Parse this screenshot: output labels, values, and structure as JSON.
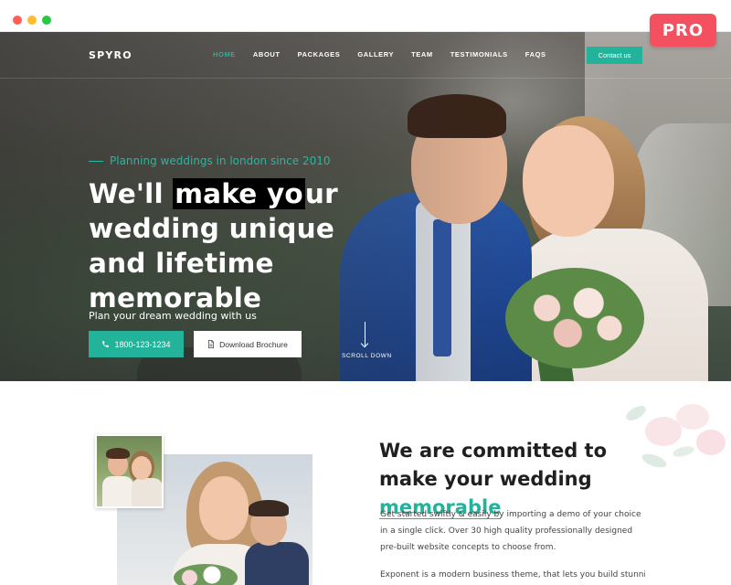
{
  "badge": {
    "label": "PRO"
  },
  "header": {
    "logo": "SPYRO",
    "nav": [
      {
        "label": "HOME",
        "active": true
      },
      {
        "label": "ABOUT",
        "active": false
      },
      {
        "label": "PACKAGES",
        "active": false
      },
      {
        "label": "GALLERY",
        "active": false
      },
      {
        "label": "TEAM",
        "active": false
      },
      {
        "label": "TESTIMONIALS",
        "active": false
      },
      {
        "label": "FAQS",
        "active": false
      }
    ],
    "contact_label": "Contact us"
  },
  "hero": {
    "tagline": "Planning weddings in london since 2010",
    "headline_before": "We'll ",
    "headline_highlight": "make yo",
    "headline_after": "ur wedding unique and lifetime memorable",
    "plan_text": "Plan your dream wedding with us",
    "phone_label": "1800-123-1234",
    "brochure_label": "Download Brochure",
    "scroll_label": "SCROLL DOWN"
  },
  "about": {
    "title_part1": "We are committed to make your wedding ",
    "title_accent": "memorable",
    "paragraph1": "Get started swiftly & easily by importing a demo of your choice in a single click. Over 30 high quality professionally designed pre-built website concepts to choose from.",
    "paragraph2": "Exponent is a modern business theme, that lets you build stunning high"
  },
  "colors": {
    "accent": "#22b39a",
    "badge": "#f4505f"
  },
  "icons": {
    "phone": "phone-icon",
    "document": "document-icon",
    "arrow": "arrow-down-icon"
  }
}
